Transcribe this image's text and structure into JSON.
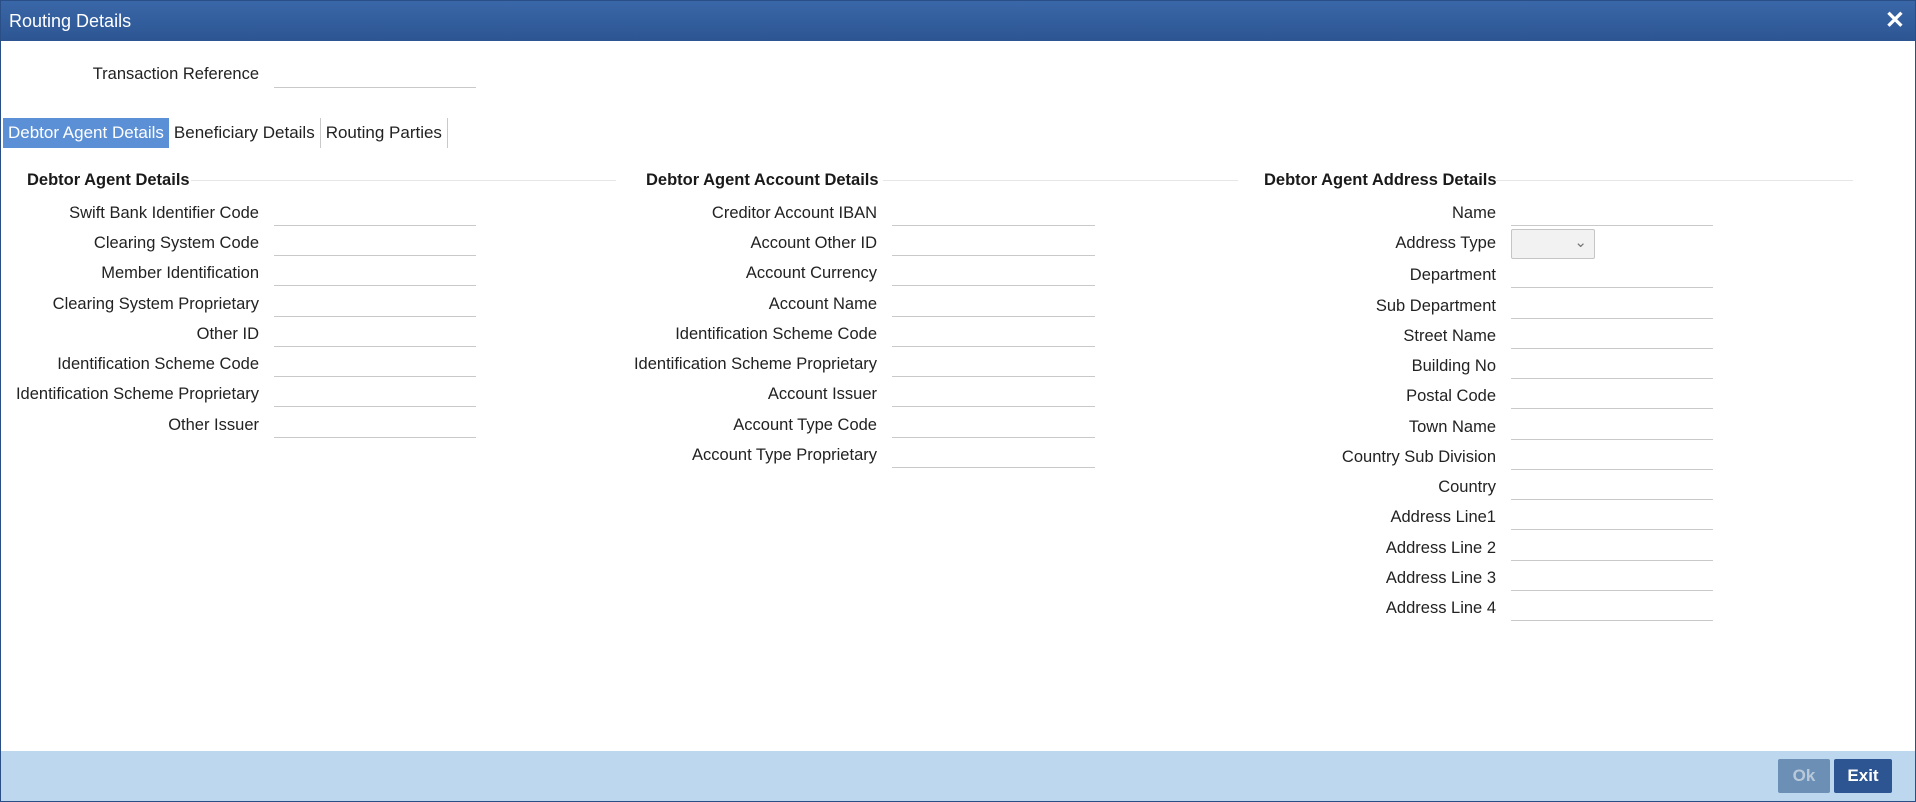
{
  "window": {
    "title": "Routing Details"
  },
  "header": {
    "transaction_reference_label": "Transaction Reference",
    "transaction_reference_value": ""
  },
  "tabs": [
    {
      "label": "Debtor Agent Details",
      "active": true
    },
    {
      "label": "Beneficiary Details",
      "active": false
    },
    {
      "label": "Routing Parties",
      "active": false
    }
  ],
  "sections": {
    "agent": {
      "title": "Debtor Agent Details",
      "fields": [
        {
          "label": "Swift Bank Identifier Code",
          "value": ""
        },
        {
          "label": "Clearing System Code",
          "value": ""
        },
        {
          "label": "Member Identification",
          "value": ""
        },
        {
          "label": "Clearing System Proprietary",
          "value": ""
        },
        {
          "label": "Other ID",
          "value": ""
        },
        {
          "label": "Identification Scheme Code",
          "value": ""
        },
        {
          "label": "Identification Scheme Proprietary",
          "value": ""
        },
        {
          "label": "Other Issuer",
          "value": ""
        }
      ]
    },
    "account": {
      "title": "Debtor Agent Account Details",
      "fields": [
        {
          "label": "Creditor Account IBAN",
          "value": ""
        },
        {
          "label": "Account Other ID",
          "value": ""
        },
        {
          "label": "Account Currency",
          "value": ""
        },
        {
          "label": "Account Name",
          "value": ""
        },
        {
          "label": "Identification Scheme Code",
          "value": ""
        },
        {
          "label": "Identification Scheme Proprietary",
          "value": ""
        },
        {
          "label": "Account Issuer",
          "value": ""
        },
        {
          "label": "Account Type Code",
          "value": ""
        },
        {
          "label": "Account Type Proprietary",
          "value": ""
        }
      ]
    },
    "address": {
      "title": "Debtor Agent Address Details",
      "fields": [
        {
          "label": "Name",
          "value": ""
        },
        {
          "label": "Address Type",
          "value": "",
          "type": "select"
        },
        {
          "label": "Department",
          "value": ""
        },
        {
          "label": "Sub Department",
          "value": ""
        },
        {
          "label": "Street Name",
          "value": ""
        },
        {
          "label": "Building No",
          "value": ""
        },
        {
          "label": "Postal Code",
          "value": ""
        },
        {
          "label": "Town Name",
          "value": ""
        },
        {
          "label": "Country Sub Division",
          "value": ""
        },
        {
          "label": "Country",
          "value": ""
        },
        {
          "label": "Address Line1",
          "value": ""
        },
        {
          "label": "Address Line 2",
          "value": ""
        },
        {
          "label": "Address Line 3",
          "value": ""
        },
        {
          "label": "Address Line 4",
          "value": ""
        }
      ]
    }
  },
  "footer": {
    "ok_label": "Ok",
    "exit_label": "Exit"
  },
  "colors": {
    "titlebar": "#2c5592",
    "active_tab": "#5b8fd6",
    "footer": "#bdd7ee"
  }
}
